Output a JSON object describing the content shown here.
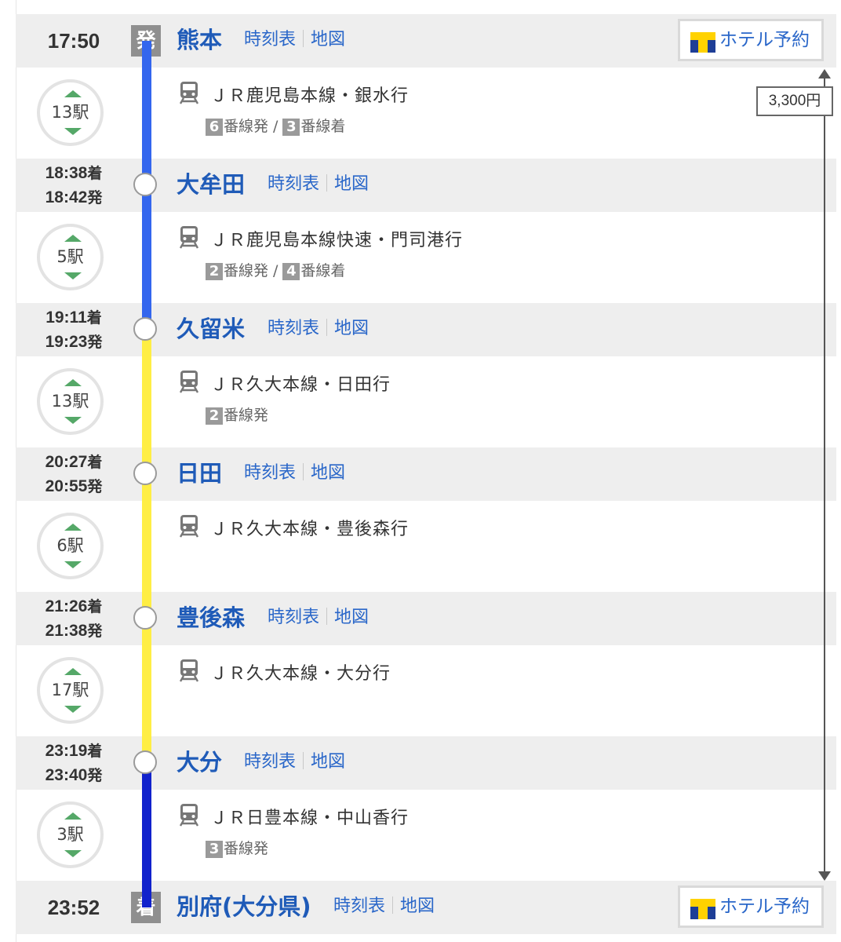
{
  "colors": {
    "link": "#2a67c9",
    "station_name": "#1f5bb8",
    "row_bg": "#eeeeee",
    "seg1_line": "#3366ee",
    "seg2_line": "#3366ee",
    "seg3_line": "#ffee44",
    "seg4_line": "#ffee44",
    "seg5_line": "#ffee44",
    "seg6_line": "#1122cc"
  },
  "links": {
    "timetable": "時刻表",
    "map": "地図"
  },
  "hotel_label": "ホテル予約",
  "fare": "3,300円",
  "stations": [
    {
      "kind": "dep",
      "time": "17:50",
      "badge": "発",
      "name": "熊本",
      "hotel": true
    },
    {
      "kind": "via",
      "arr_time": "18:38",
      "arr_suffix": "着",
      "dep_time": "18:42",
      "dep_suffix": "発",
      "name": "大牟田"
    },
    {
      "kind": "via",
      "arr_time": "19:11",
      "arr_suffix": "着",
      "dep_time": "19:23",
      "dep_suffix": "発",
      "name": "久留米"
    },
    {
      "kind": "via",
      "arr_time": "20:27",
      "arr_suffix": "着",
      "dep_time": "20:55",
      "dep_suffix": "発",
      "name": "日田"
    },
    {
      "kind": "via",
      "arr_time": "21:26",
      "arr_suffix": "着",
      "dep_time": "21:38",
      "dep_suffix": "発",
      "name": "豊後森"
    },
    {
      "kind": "via",
      "arr_time": "23:19",
      "arr_suffix": "着",
      "dep_time": "23:40",
      "dep_suffix": "発",
      "name": "大分"
    },
    {
      "kind": "arr",
      "time": "23:52",
      "badge": "着",
      "name": "別府(大分県)",
      "hotel": true
    }
  ],
  "segments": [
    {
      "stops": "13駅",
      "line": "ＪＲ鹿児島本線・銀水行",
      "dep_platform": "6",
      "dep_platform_label": "番線発",
      "arr_platform": "3",
      "arr_platform_label": "番線着",
      "icon": "train-icon"
    },
    {
      "stops": "5駅",
      "line": "ＪＲ鹿児島本線快速・門司港行",
      "dep_platform": "2",
      "dep_platform_label": "番線発",
      "arr_platform": "4",
      "arr_platform_label": "番線着",
      "icon": "train-icon"
    },
    {
      "stops": "13駅",
      "line": "ＪＲ久大本線・日田行",
      "dep_platform": "2",
      "dep_platform_label": "番線発",
      "icon": "train-icon"
    },
    {
      "stops": "6駅",
      "line": "ＪＲ久大本線・豊後森行",
      "icon": "train-icon"
    },
    {
      "stops": "17駅",
      "line": "ＪＲ久大本線・大分行",
      "icon": "train-icon"
    },
    {
      "stops": "3駅",
      "line": "ＪＲ日豊本線・中山香行",
      "dep_platform": "3",
      "dep_platform_label": "番線発",
      "icon": "train-icon"
    }
  ]
}
